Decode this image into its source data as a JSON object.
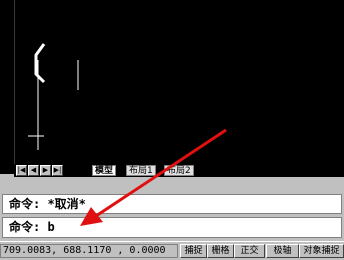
{
  "layout_tabs": [
    "模型",
    "布局1",
    "布局2"
  ],
  "command_history": "命令: *取消*",
  "command_prompt": "命令: b",
  "status": {
    "coordinates": "709.0083,  688.1170 , 0.0000",
    "buttons": [
      "捕捉",
      "栅格",
      "正交",
      "极轴",
      "对象捕捉"
    ]
  },
  "icons": [
    "nav-first-icon",
    "nav-prev-icon",
    "nav-next-icon",
    "nav-last-icon"
  ],
  "colors": {
    "canvas": "#000000",
    "annotation_arrow": "#e01010",
    "ui_gray": "#c0c0c0"
  }
}
